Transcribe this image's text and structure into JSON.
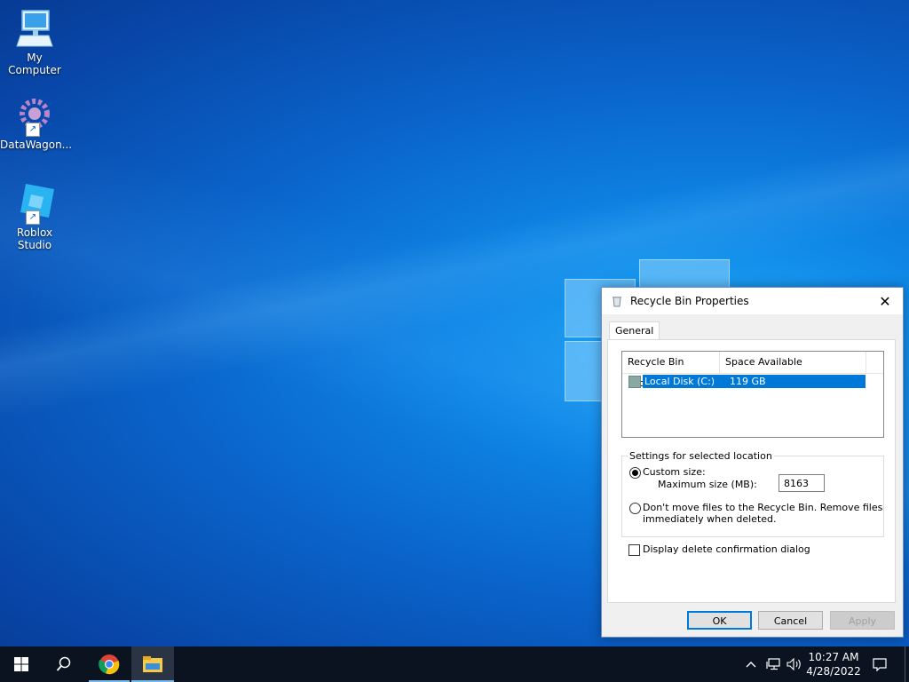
{
  "desktop": {
    "icons": [
      {
        "label": "My Computer",
        "icon": "computer-icon"
      },
      {
        "label": "DataWagon...",
        "icon": "datawagon-icon"
      },
      {
        "label": "Roblox Studio",
        "icon": "roblox-studio-icon"
      }
    ]
  },
  "dialog": {
    "title": "Recycle Bin Properties",
    "close_glyph": "✕",
    "tab_general": "General",
    "list": {
      "columns": [
        "Recycle Bin Location",
        "Space Available"
      ],
      "rows": [
        {
          "location": "Local Disk (C:)",
          "space": "119 GB",
          "selected": true
        }
      ]
    },
    "group_label": "Settings for selected location",
    "custom_size_label": "Custom size:",
    "max_size_label": "Maximum size (MB):",
    "max_size_value": "8163",
    "dont_move_line1": "Don't move files to the Recycle Bin. Remove files",
    "dont_move_line2": "immediately when deleted.",
    "confirm_label": "Display delete confirmation dialog",
    "ok_label": "OK",
    "cancel_label": "Cancel",
    "apply_label": "Apply"
  },
  "taskbar": {
    "time": "10:27 AM",
    "date": "4/28/2022",
    "apps": [
      "start-icon",
      "search-icon",
      "chrome-icon",
      "file-explorer-icon"
    ]
  },
  "colors": {
    "selection": "#0078d7",
    "taskbar": "#0b1321"
  }
}
